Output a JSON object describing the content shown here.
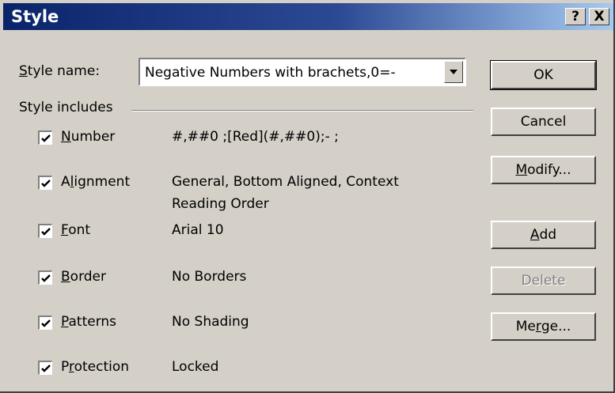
{
  "window": {
    "title": "Style",
    "help_label": "?",
    "close_label": "X"
  },
  "style_name": {
    "label": "Style name:",
    "value": "Negative Numbers with brachets,0=-"
  },
  "group": {
    "label": "Style includes"
  },
  "includes": [
    {
      "label": "Number",
      "checked": true,
      "desc": "#,##0 ;[Red](#,##0);-    ;",
      "desc2": ""
    },
    {
      "label": "Alignment",
      "checked": true,
      "desc": "General, Bottom Aligned, Context",
      "desc2": "Reading Order"
    },
    {
      "label": "Font",
      "checked": true,
      "desc": "Arial 10",
      "desc2": ""
    },
    {
      "label": "Border",
      "checked": true,
      "desc": "No Borders",
      "desc2": ""
    },
    {
      "label": "Patterns",
      "checked": true,
      "desc": "No Shading",
      "desc2": ""
    },
    {
      "label": "Protection",
      "checked": true,
      "desc": "Locked",
      "desc2": ""
    }
  ],
  "buttons": {
    "ok": "OK",
    "cancel": "Cancel",
    "modify": "Modify...",
    "add": "Add",
    "delete": "Delete",
    "merge": "Merge..."
  }
}
